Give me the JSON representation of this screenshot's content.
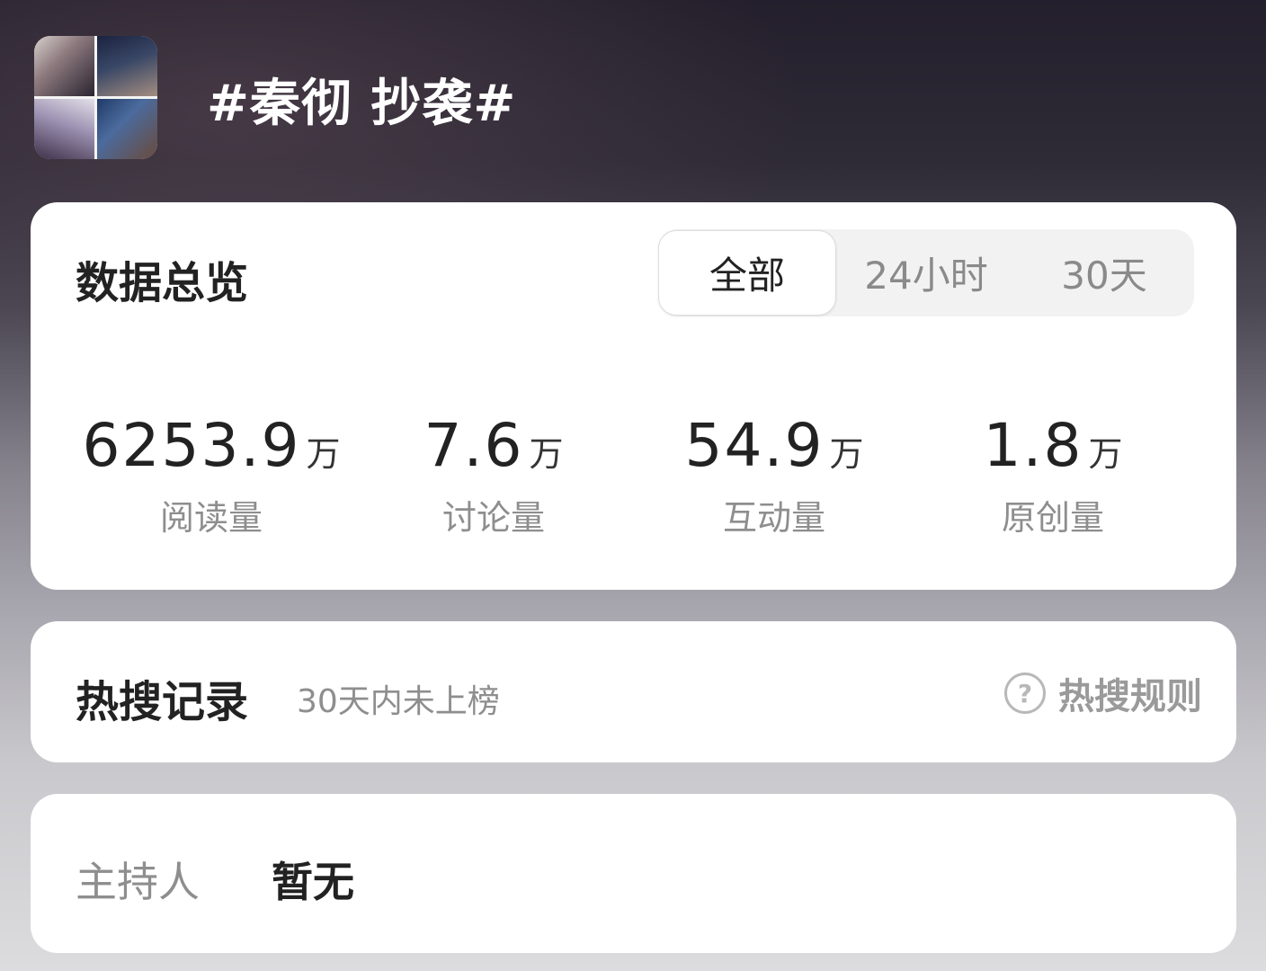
{
  "header": {
    "cover_icon": "topic-cover-image",
    "title": "#秦彻 抄袭#"
  },
  "overview": {
    "title": "数据总览",
    "tabs": [
      {
        "label": "全部",
        "active": true
      },
      {
        "label": "24小时",
        "active": false
      },
      {
        "label": "30天",
        "active": false
      }
    ],
    "stats": [
      {
        "value": "6253.9",
        "unit": "万",
        "label": "阅读量"
      },
      {
        "value": "7.6",
        "unit": "万",
        "label": "讨论量"
      },
      {
        "value": "54.9",
        "unit": "万",
        "label": "互动量"
      },
      {
        "value": "1.8",
        "unit": "万",
        "label": "原创量"
      }
    ]
  },
  "hot_search": {
    "title": "热搜记录",
    "subtitle": "30天内未上榜",
    "rule_icon": "question-circle-icon",
    "rule_icon_glyph": "?",
    "rule_label": "热搜规则"
  },
  "host": {
    "label": "主持人",
    "value": "暂无"
  }
}
